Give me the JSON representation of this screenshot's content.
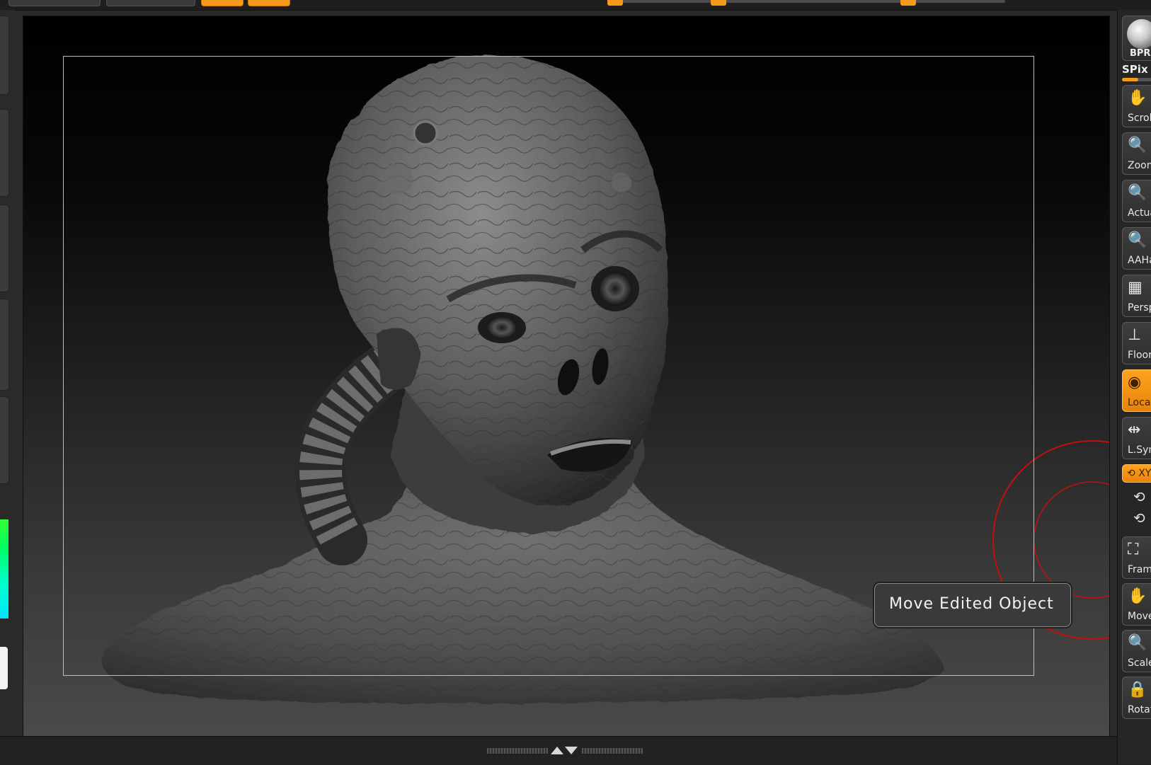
{
  "right_shelf": {
    "bpr_label": "BPR",
    "spix_label": "SPix",
    "spix_level": 0.55,
    "buttons": [
      {
        "key": "scroll",
        "label": "Scroll",
        "icon": "hand-icon",
        "active": false
      },
      {
        "key": "zoom",
        "label": "Zoom",
        "icon": "magnifier-icon",
        "active": false
      },
      {
        "key": "actual",
        "label": "Actual",
        "icon": "magnifier-icon",
        "active": false
      },
      {
        "key": "aahalf",
        "label": "AAHalf",
        "icon": "magnifier-icon",
        "active": false
      },
      {
        "key": "persp",
        "label": "Persp",
        "icon": "perspective-grid-icon",
        "active": false
      },
      {
        "key": "floor",
        "label": "Floor",
        "icon": "floor-icon",
        "active": false
      },
      {
        "key": "local",
        "label": "Local",
        "icon": "local-transform-icon",
        "active": true
      },
      {
        "key": "lsym",
        "label": "L.Sym",
        "icon": "local-symmetry-icon",
        "active": false
      },
      {
        "key": "frame",
        "label": "Frame",
        "icon": "frame-icon",
        "active": false
      },
      {
        "key": "move",
        "label": "Move",
        "icon": "hand-icon",
        "active": false
      },
      {
        "key": "scale",
        "label": "Scale",
        "icon": "magnifier-icon",
        "active": false
      },
      {
        "key": "rotate",
        "label": "Rotate",
        "icon": "rotate-lock-icon",
        "active": false
      }
    ],
    "xyz_label": "XYZ"
  },
  "tooltip": {
    "text": "Move Edited Object"
  },
  "colors": {
    "accent": "#f59a1b",
    "gizmo_red": "#c01010"
  }
}
